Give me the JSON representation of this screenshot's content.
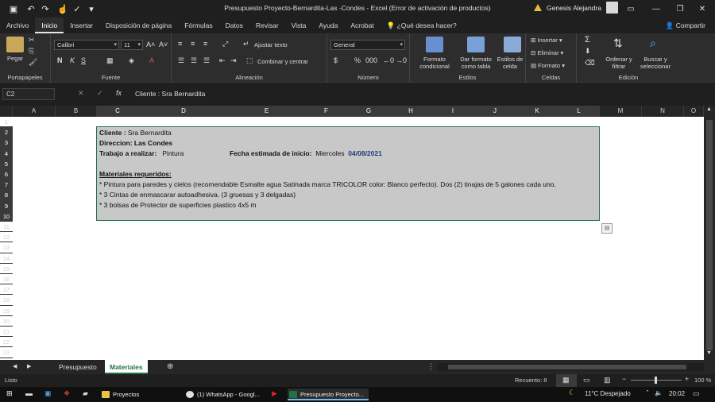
{
  "window": {
    "title": "Presupuesto Proyecto-Bernardita-Las -Condes  -  Excel (Error de activación de productos)",
    "user": "Genesis Alejandra"
  },
  "tabs": [
    "Archivo",
    "Inicio",
    "Insertar",
    "Disposición de página",
    "Fórmulas",
    "Datos",
    "Revisar",
    "Vista",
    "Ayuda",
    "Acrobat",
    "¿Qué desea hacer?"
  ],
  "active_tab": "Inicio",
  "share_label": "Compartir",
  "ribbon": {
    "clipboard": {
      "label": "Portapapeles",
      "paste": "Pegar"
    },
    "font": {
      "label": "Fuente",
      "name": "Calibri",
      "size": "11"
    },
    "alignment": {
      "label": "Alineación",
      "wrap": "Ajustar texto",
      "merge": "Combinar y centrar"
    },
    "number": {
      "label": "Número",
      "format": "General"
    },
    "styles": {
      "label": "Estilos",
      "cond": [
        "Formato",
        "condicional"
      ],
      "table": [
        "Dar formato",
        "como tabla"
      ],
      "cell": [
        "Estilos de",
        "celda"
      ]
    },
    "cells": {
      "label": "Celdas",
      "insert": "Insertar",
      "delete": "Eliminar",
      "format": "Formato"
    },
    "editing": {
      "label": "Edición",
      "sort": [
        "Ordenar y",
        "filtrar"
      ],
      "find": [
        "Buscar y",
        "seleccionar"
      ]
    }
  },
  "formula_bar": {
    "name_box": "C2",
    "content": "Cliente : Sra Bernardita"
  },
  "columns": [
    {
      "name": "A"
    },
    {
      "name": "B"
    },
    {
      "name": "C"
    },
    {
      "name": "D"
    },
    {
      "name": "E"
    },
    {
      "name": "F"
    },
    {
      "name": "G"
    },
    {
      "name": "H"
    },
    {
      "name": "I"
    },
    {
      "name": "J"
    },
    {
      "name": "K"
    },
    {
      "name": "L"
    },
    {
      "name": "M"
    },
    {
      "name": "N"
    },
    {
      "name": "O"
    }
  ],
  "rows": [
    "1",
    "2",
    "3",
    "4",
    "5",
    "6",
    "7",
    "8",
    "9",
    "10",
    "11",
    "12",
    "13",
    "14",
    "15",
    "16",
    "17",
    "18",
    "19",
    "20",
    "21",
    "22",
    "23"
  ],
  "content": {
    "client_label": "Cliente :",
    "client_value": "Sra Bernardita",
    "direction": "Direccion: Las Condes",
    "work_label": "Trabajo a realizar:",
    "work_value": "Pintura",
    "date_label": "Fecha estimada de inicio:",
    "date_day": "Miercoles",
    "date_value": "04/08/2021",
    "materials_title": "Materiales requeridos:",
    "m1": "* Pintura para paredes y cielos  (recomendable Esmalte agua Satinada marca TRICOLOR color: Blanco perfecto). Dos (2) tinajas de 5 galones cada uno.",
    "m2": "* 3 Cintas de enmascarar  autoadhesiva. (3 gruesas y 3 delgadas)",
    "m3": "* 3 bolsas de Protector de superficies plastico 4x5 m"
  },
  "sheets": [
    "Presupuesto",
    "Materiales"
  ],
  "active_sheet": "Materiales",
  "status": {
    "ready": "Listo",
    "count": "Recuento: 8",
    "zoom": "100 %"
  },
  "taskbar": {
    "items": [
      "Proyectos",
      "(1) WhatsApp - Googl...",
      "Presupuesto Proyecto..."
    ],
    "weather": "11°C  Despejado",
    "time": "20:02"
  }
}
